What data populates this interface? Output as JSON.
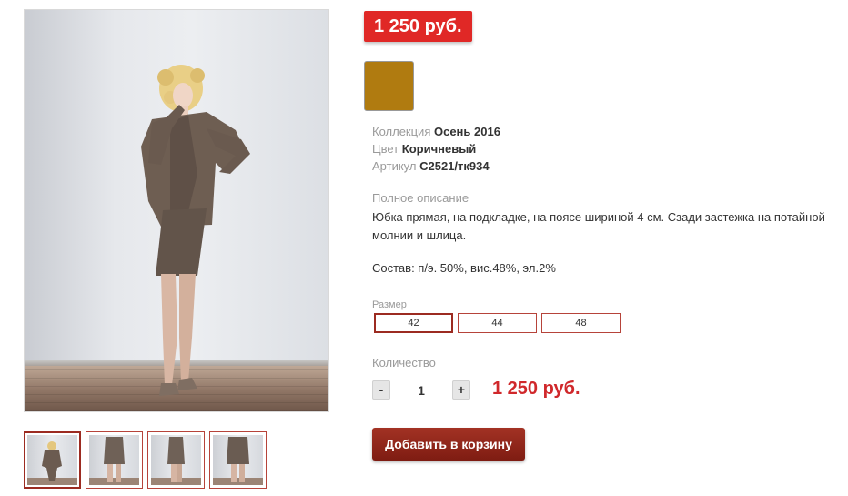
{
  "product": {
    "price_badge": "1 250 руб.",
    "color_swatch": "#b07b10",
    "attributes": [
      {
        "label": "Коллекция",
        "value": "Осень 2016"
      },
      {
        "label": "Цвет",
        "value": "Коричневый"
      },
      {
        "label": "Артикул",
        "value": "С2521/тк934"
      }
    ],
    "description_title": "Полное описание",
    "description": "Юбка прямая, на подкладке, на поясе шириной 4 см. Сзади застежка на потайной молнии и шлица.",
    "composition": "Состав: п/э. 50%, вис.48%, эл.2%",
    "size_title": "Размер",
    "sizes": [
      "42",
      "44",
      "48"
    ],
    "selected_size": "42",
    "quantity_title": "Количество",
    "quantity_minus": "-",
    "quantity_plus": "+",
    "quantity_value": "1",
    "total_price": "1 250 руб.",
    "add_to_cart": "Добавить в корзину"
  },
  "gallery": {
    "thumbnails": [
      "full-look",
      "skirt-front",
      "skirt-side",
      "skirt-back"
    ],
    "active_index": 0
  },
  "colors": {
    "accent_red": "#e02826",
    "button_dark_red": "#8e2419",
    "border_red": "#b6433a"
  }
}
